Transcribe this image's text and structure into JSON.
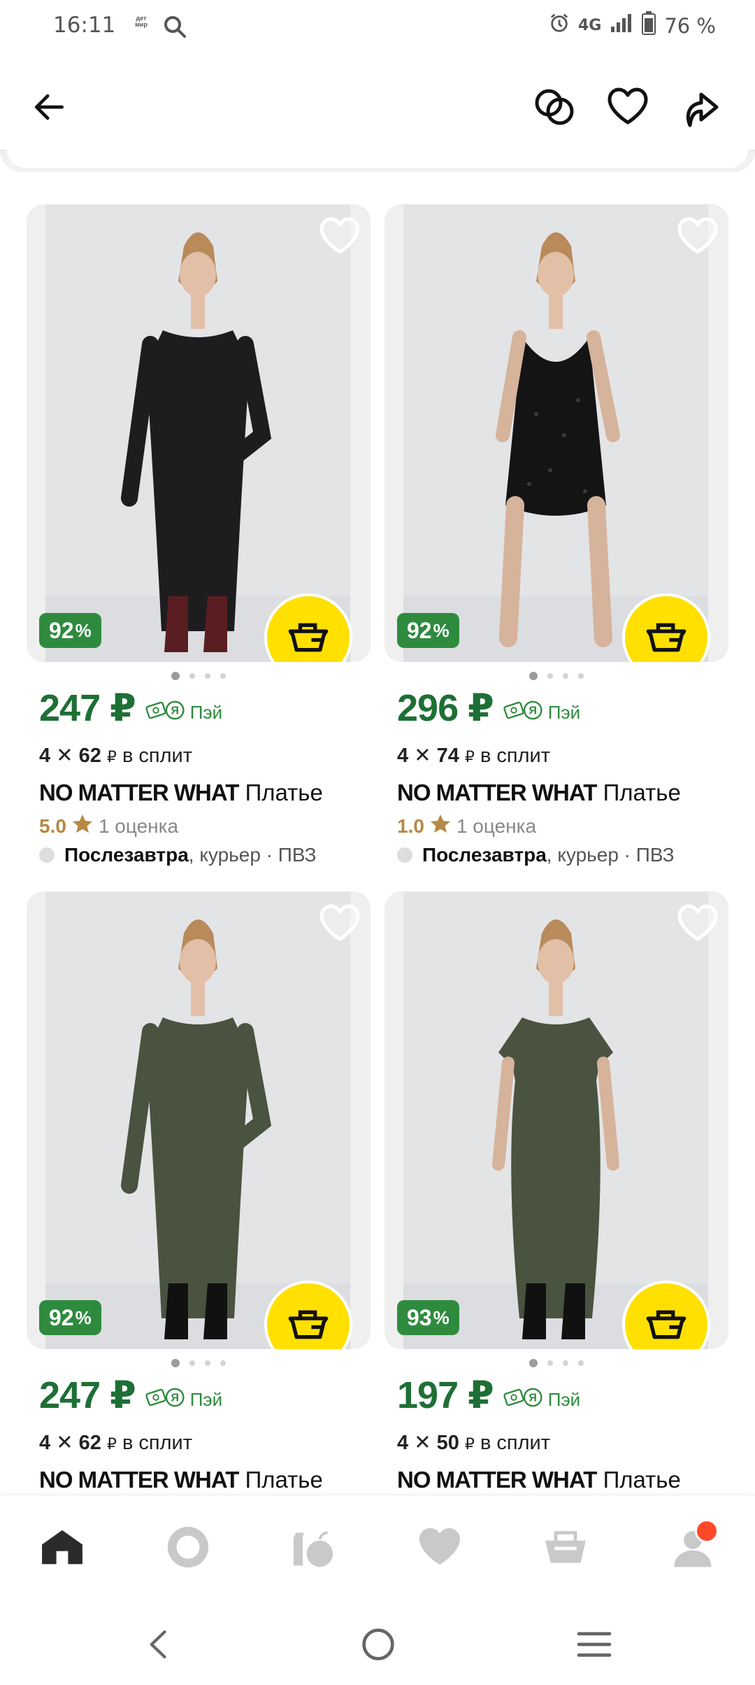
{
  "status_bar": {
    "time": "16:11",
    "app_icon_text": "дет мир",
    "network": "4G",
    "battery": "76 %"
  },
  "colors": {
    "price_green": "#1e6f35",
    "discount_green": "#2e8b3e",
    "cart_yellow": "#ffe000",
    "rating_gold": "#b48a45",
    "notification_red": "#ff4a2a"
  },
  "products": [
    {
      "discount": "92",
      "discount_unit": "%",
      "price": "247 ₽",
      "pay_label": "Пэй",
      "split_count": "4",
      "split_amount": "62",
      "split_currency": "₽",
      "split_text": "в сплит",
      "brand": "NO MATTER WHAT",
      "name": "Платье",
      "rating": "5.0",
      "reviews": "1 оценка",
      "delivery_day": "Послезавтра",
      "delivery_rest": ", курьер · ПВЗ",
      "dress_color": "#1d1d1f",
      "dress_style": "longsleeve-maxi",
      "boot_color": "#5a1e22",
      "image_dots": 4,
      "active_dot": 0
    },
    {
      "discount": "92",
      "discount_unit": "%",
      "price": "296 ₽",
      "pay_label": "Пэй",
      "split_count": "4",
      "split_amount": "74",
      "split_currency": "₽",
      "split_text": "в сплит",
      "brand": "NO MATTER WHAT",
      "name": "Платье",
      "rating": "1.0",
      "reviews": "1 оценка",
      "delivery_day": "Послезавтра",
      "delivery_rest": ", курьер · ПВЗ",
      "dress_color": "#141414",
      "dress_style": "sequin-mini",
      "boot_color": "",
      "image_dots": 4,
      "active_dot": 0
    },
    {
      "discount": "92",
      "discount_unit": "%",
      "price": "247 ₽",
      "pay_label": "Пэй",
      "split_count": "4",
      "split_amount": "62",
      "split_currency": "₽",
      "split_text": "в сплит",
      "brand": "NO MATTER WHAT",
      "name": "Платье",
      "dress_color": "#4a5240",
      "dress_style": "longsleeve-maxi",
      "boot_color": "#111111",
      "image_dots": 4,
      "active_dot": 0
    },
    {
      "discount": "93",
      "discount_unit": "%",
      "price": "197 ₽",
      "pay_label": "Пэй",
      "split_count": "4",
      "split_amount": "50",
      "split_currency": "₽",
      "split_text": "в сплит",
      "brand": "NO MATTER WHAT",
      "name": "Платье",
      "dress_color": "#4a5240",
      "dress_style": "shortsleeve-midi",
      "boot_color": "#111111",
      "image_dots": 4,
      "active_dot": 0
    }
  ],
  "bottom_nav": [
    {
      "id": "home",
      "icon": "home-icon",
      "active": true
    },
    {
      "id": "alice",
      "icon": "alice-icon",
      "active": false
    },
    {
      "id": "grocery",
      "icon": "grocery-icon",
      "active": false
    },
    {
      "id": "favorites",
      "icon": "heart-icon",
      "active": false
    },
    {
      "id": "cart",
      "icon": "cart-icon",
      "active": false
    },
    {
      "id": "profile",
      "icon": "profile-icon",
      "active": false,
      "has_badge": true
    }
  ]
}
